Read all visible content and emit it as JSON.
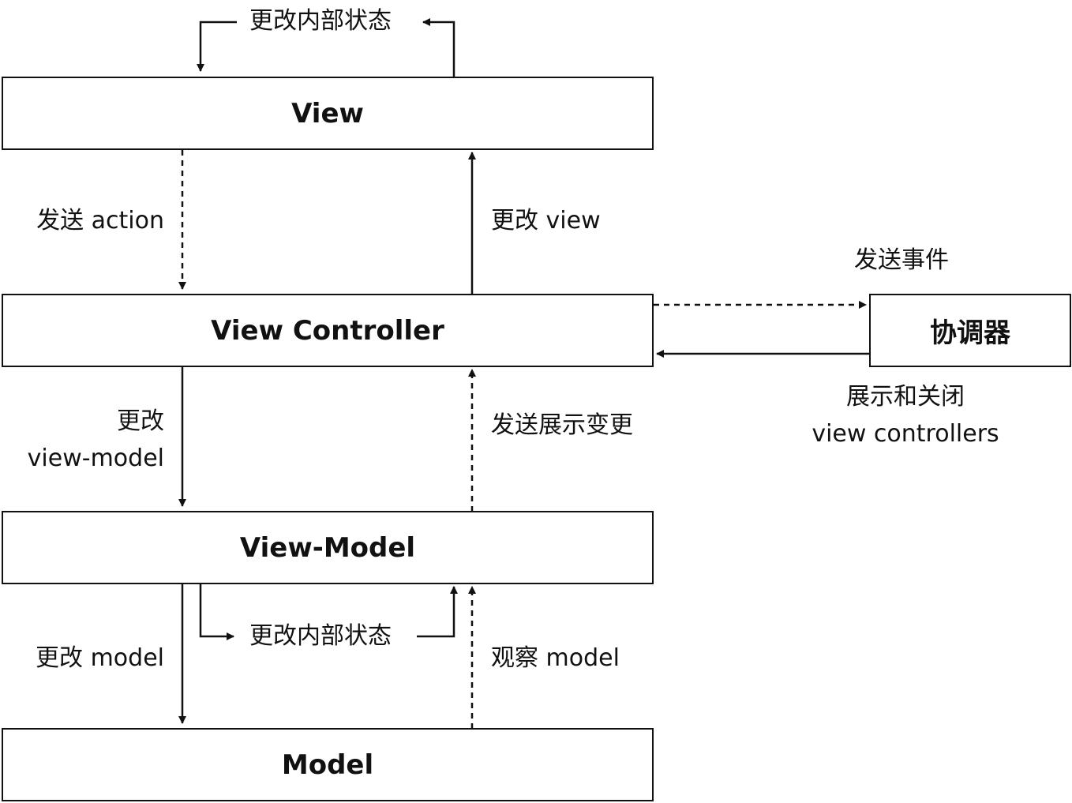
{
  "nodes": {
    "view": "View",
    "view_controller": "View Controller",
    "view_model": "View-Model",
    "model": "Model",
    "coordinator": "协调器"
  },
  "edges": {
    "view_internal_state": "更改内部状态",
    "send_action": "发送 action",
    "change_view": "更改 view",
    "send_event": "发送事件",
    "present_dismiss_line1": "展示和关闭",
    "present_dismiss_line2": "view controllers",
    "change_view_model_line1": "更改",
    "change_view_model_line2": "view-model",
    "send_presentation_change": "发送展示变更",
    "viewmodel_internal_state": "更改内部状态",
    "change_model": "更改 model",
    "observe_model": "观察 model"
  },
  "colors": {
    "stroke": "#111111",
    "background": "#ffffff"
  }
}
